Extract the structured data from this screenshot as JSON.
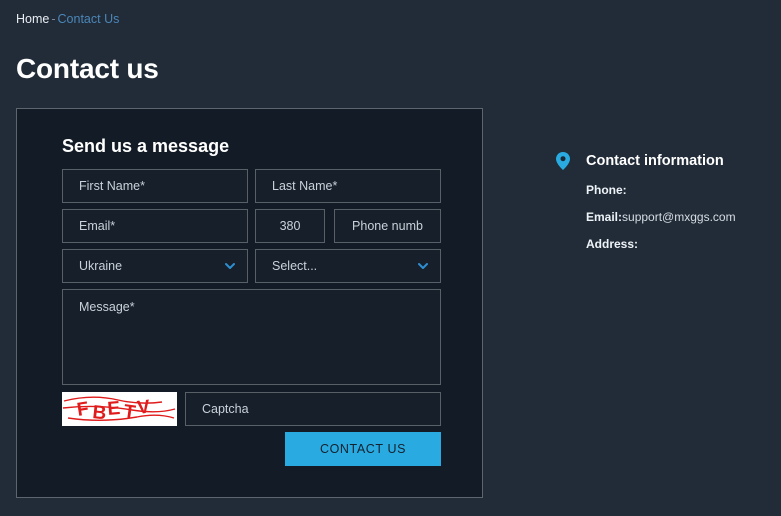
{
  "breadcrumb": {
    "home_label": "Home",
    "separator": "-",
    "current_label": "Contact Us"
  },
  "page": {
    "title": "Contact us"
  },
  "form": {
    "heading": "Send us a message",
    "fields": {
      "first_name": {
        "placeholder": "First Name*",
        "value": ""
      },
      "last_name": {
        "placeholder": "Last Name*",
        "value": ""
      },
      "email": {
        "placeholder": "Email*",
        "value": ""
      },
      "country_code": {
        "value": "380"
      },
      "phone": {
        "placeholder": "Phone numb",
        "value": ""
      },
      "country_select": {
        "selected": "Ukraine",
        "icon": "chevron-down-icon"
      },
      "topic_select": {
        "selected": "Select...",
        "icon": "chevron-down-icon"
      },
      "message": {
        "placeholder": "Message*",
        "value": ""
      },
      "captcha_input": {
        "placeholder": "Captcha",
        "value": ""
      }
    },
    "captcha_image": {
      "icon": "captcha-image",
      "text": "FBETV",
      "text_color": "#e01b1b",
      "background": "#ffffff"
    },
    "submit": {
      "label": "CONTACT US",
      "background": "#29abe2",
      "text_color": "#14212e"
    }
  },
  "contact_information": {
    "icon": "map-pin-icon",
    "title": "Contact information",
    "rows": [
      {
        "label": "Phone:",
        "value": ""
      },
      {
        "label": "Email:",
        "value": "support@mxggs.com"
      },
      {
        "label": "Address:",
        "value": ""
      }
    ]
  },
  "colors": {
    "page_background": "#222c38",
    "card_background": "#131c26",
    "card_border": "#5d666f",
    "field_border": "#595f66",
    "accent_blue": "#29abe2",
    "link_blue": "#4a86b8",
    "text_primary": "#ffffff",
    "text_muted": "#c9d2da"
  }
}
